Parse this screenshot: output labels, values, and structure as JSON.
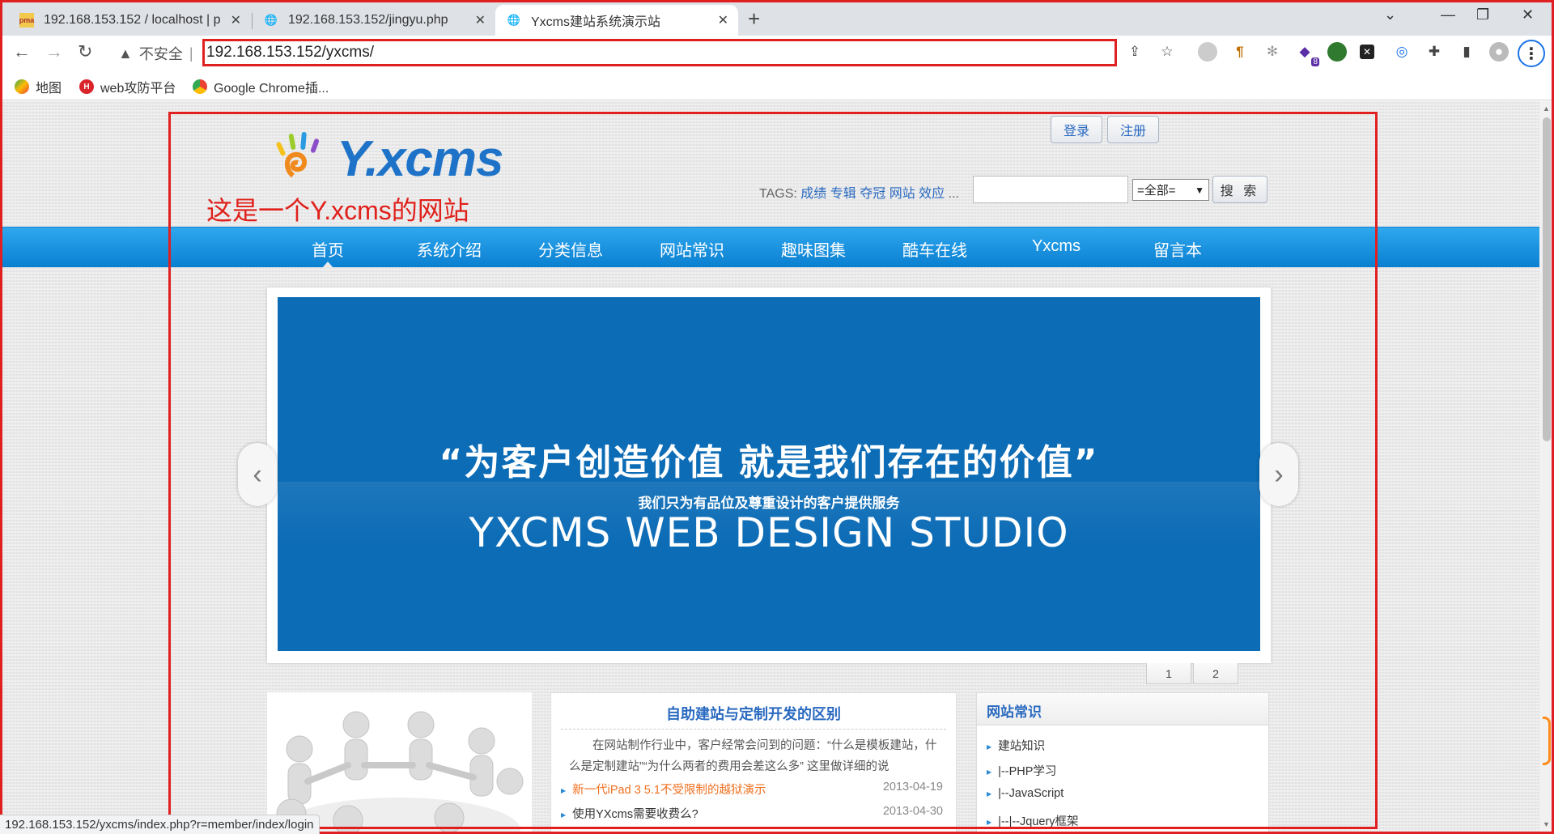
{
  "browser": {
    "tabs": [
      {
        "title": "192.168.153.152 / localhost | p",
        "active": false
      },
      {
        "title": "192.168.153.152/jingyu.php",
        "active": false
      },
      {
        "title": "Yxcms建站系统演示站",
        "active": true
      }
    ],
    "new_tab_label": "+",
    "security_label": "不安全",
    "address": "192.168.153.152/yxcms/",
    "bookmarks": [
      "地图",
      "web攻防平台",
      "Google Chrome插..."
    ],
    "extension_badge": "8",
    "status_url": "192.168.153.152/yxcms/index.php?r=member/index/login"
  },
  "site": {
    "top_links": {
      "login": "登录",
      "register": "注册"
    },
    "logo_text": "Y.xcms",
    "annotation": "这是一个Y.xcms的网站",
    "tags_label": "TAGS:",
    "tags": [
      "成绩",
      "专辑",
      "夺冠",
      "网站",
      "效应"
    ],
    "tags_more": "...",
    "search_placeholder": "",
    "search_scope": "=全部=",
    "search_button": "搜 索",
    "nav": [
      "首页",
      "系统介绍",
      "分类信息",
      "网站常识",
      "趣味图集",
      "酷车在线",
      "Yxcms",
      "留言本"
    ],
    "slider": {
      "quote": "“为客户创造价值  就是我们存在的价值”",
      "subtitle": "我们只为有品位及尊重设计的客户提供服务",
      "english": "YXCMS WEB DESIGN STUDIO",
      "prev_label": "‹",
      "next_label": "›",
      "pages": [
        "1",
        "2"
      ]
    },
    "article": {
      "title": "自助建站与定制开发的区别",
      "excerpt": "在网站制作行业中，客户经常会问到的问题：“什么是模板建站，什么是定制建站”“为什么两者的费用会差这么多” 这里做详细的说",
      "news": [
        {
          "title": "新一代iPad 3 5.1不受限制的越狱演示",
          "date": "2013-04-19",
          "highlight": true
        },
        {
          "title": "使用YXcms需要收费么?",
          "date": "2013-04-30",
          "highlight": false
        }
      ]
    },
    "sidebar": {
      "title": "网站常识",
      "items": [
        "建站知识",
        "|--PHP学习",
        "|--JavaScript",
        "|--|--Jquery框架"
      ]
    }
  },
  "colors": {
    "frame_red": "#e02020",
    "nav_blue": "#0a7fd1",
    "slide_blue": "#0c6cb6",
    "link_blue": "#2a6ac0",
    "news_highlight": "#f07020"
  }
}
